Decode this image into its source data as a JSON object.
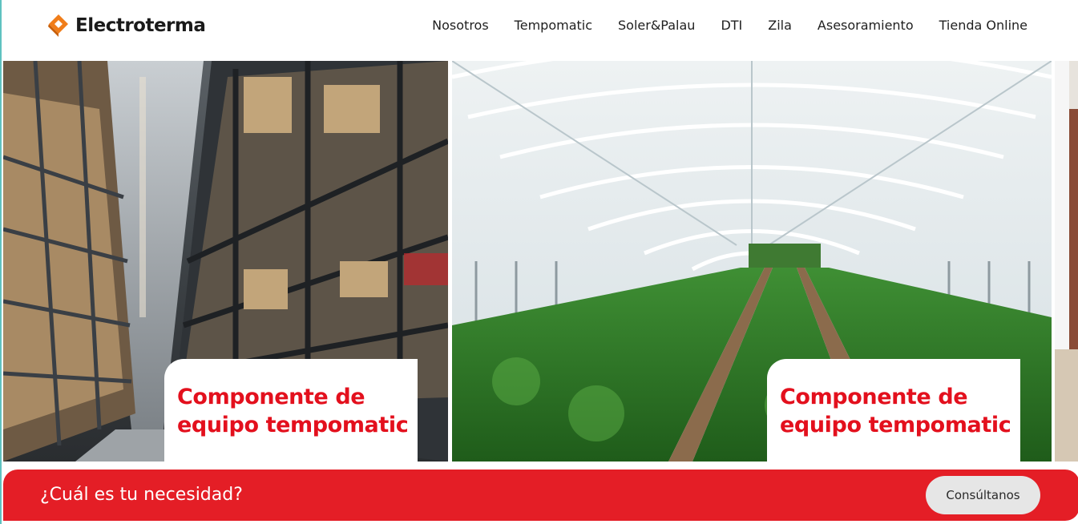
{
  "brand": {
    "name": "Electroterma",
    "accent": "#f07d1a",
    "red": "#e41e26"
  },
  "nav": {
    "items": [
      {
        "label": "Nosotros"
      },
      {
        "label": "Tempomatic"
      },
      {
        "label": "Soler&Palau"
      },
      {
        "label": "DTI"
      },
      {
        "label": "Zila"
      },
      {
        "label": "Asesoramiento"
      },
      {
        "label": "Tienda Online"
      }
    ]
  },
  "slides": [
    {
      "image": "warehouse-aisle-photo",
      "title": "Componente de equipo tempomatic"
    },
    {
      "image": "greenhouse-crops-photo",
      "title": "Componente de equipo tempomatic"
    },
    {
      "image": "partial-next-slide-photo"
    }
  ],
  "cta": {
    "text": "¿Cuál es tu necesidad?",
    "button_label": "Consúltanos"
  }
}
